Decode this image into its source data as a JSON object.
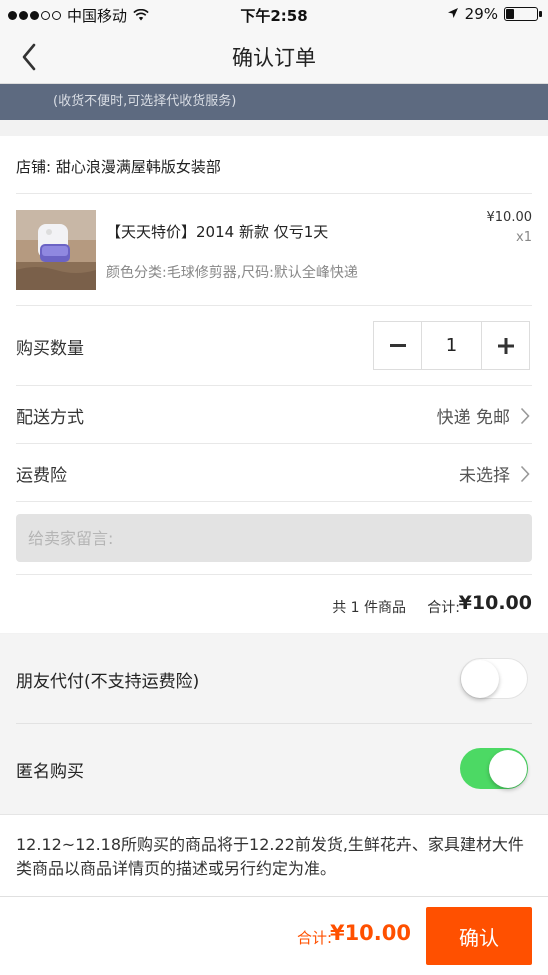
{
  "status_bar": {
    "carrier": "中国移动",
    "time": "下午2:58",
    "battery_text": "29%",
    "battery_level": 0.29
  },
  "nav": {
    "title": "确认订单"
  },
  "banner": {
    "text": "(收货不便时,可选择代收货服务)"
  },
  "shop": {
    "label": "店铺:",
    "name": "甜心浪漫满屋韩版女装部"
  },
  "product": {
    "name": "【天天特价】2014 新款 仅亏1天",
    "spec": "颜色分类:毛球修剪器,尺码:默认全峰快递",
    "price": "¥10.00",
    "qty": "x1"
  },
  "quantity": {
    "label": "购买数量",
    "minus": "−",
    "value": "1",
    "plus": "+"
  },
  "shipping": {
    "label": "配送方式",
    "value": "快递 免邮"
  },
  "insurance": {
    "label": "运费险",
    "value": "未选择"
  },
  "message": {
    "placeholder": "给卖家留言:"
  },
  "summary": {
    "count_text": "共 1 件商品",
    "total_label": "合计:",
    "total": "¥10.00"
  },
  "friend_pay": {
    "label": "朋友代付(不支持运费险)",
    "on": false
  },
  "anonymous": {
    "label": "匿名购买",
    "on": true
  },
  "notice": {
    "text": "12.12~12.18所购买的商品将于12.22前发货,生鲜花卉、家具建材大件类商品以商品详情页的描述或另行约定为准。"
  },
  "footer": {
    "total_label": "合计:",
    "total": "¥10.00",
    "confirm_label": "确认"
  },
  "colors": {
    "accent": "#ff5000",
    "banner_bg": "#5d6a80",
    "toggle_on": "#4cd964"
  }
}
